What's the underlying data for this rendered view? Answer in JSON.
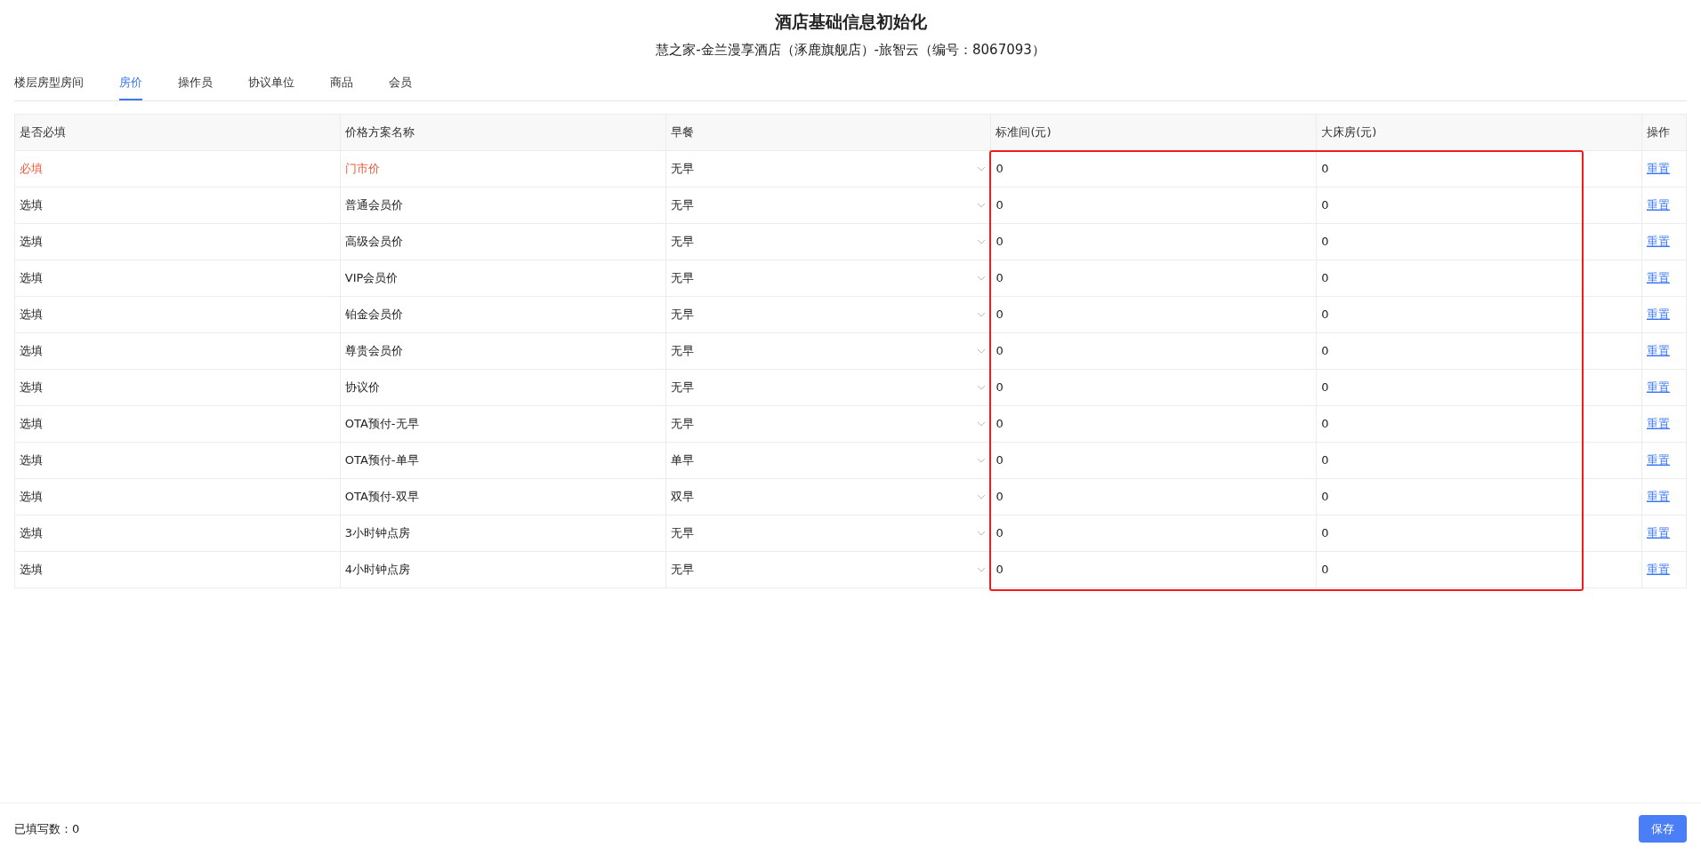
{
  "title": "酒店基础信息初始化",
  "subtitle": "慧之家-金兰漫享酒店（涿鹿旗舰店）-旅智云（编号：8067093）",
  "tabs": [
    {
      "label": "楼层房型房间",
      "selected": false
    },
    {
      "label": "房价",
      "selected": true
    },
    {
      "label": "操作员",
      "selected": false
    },
    {
      "label": "协议单位",
      "selected": false
    },
    {
      "label": "商品",
      "selected": false
    },
    {
      "label": "会员",
      "selected": false
    }
  ],
  "table": {
    "highlight_frame": true,
    "columns": [
      {
        "label": "是否必填",
        "kind": "text"
      },
      {
        "label": "价格方案名称",
        "kind": "text"
      },
      {
        "label": "早餐",
        "kind": "select"
      },
      {
        "label": "标准间(元)",
        "kind": "price"
      },
      {
        "label": "大床房(元)",
        "kind": "price"
      },
      {
        "label": "操作",
        "kind": "action"
      }
    ],
    "rows": [
      {
        "required": true,
        "requirement": "必填",
        "plan": "门市价",
        "breakfast": "无早",
        "standard": "0",
        "king": "0",
        "action": "重置"
      },
      {
        "required": false,
        "requirement": "选填",
        "plan": "普通会员价",
        "breakfast": "无早",
        "standard": "0",
        "king": "0",
        "action": "重置"
      },
      {
        "required": false,
        "requirement": "选填",
        "plan": "高级会员价",
        "breakfast": "无早",
        "standard": "0",
        "king": "0",
        "action": "重置"
      },
      {
        "required": false,
        "requirement": "选填",
        "plan": "VIP会员价",
        "breakfast": "无早",
        "standard": "0",
        "king": "0",
        "action": "重置"
      },
      {
        "required": false,
        "requirement": "选填",
        "plan": "铂金会员价",
        "breakfast": "无早",
        "standard": "0",
        "king": "0",
        "action": "重置"
      },
      {
        "required": false,
        "requirement": "选填",
        "plan": "尊贵会员价",
        "breakfast": "无早",
        "standard": "0",
        "king": "0",
        "action": "重置"
      },
      {
        "required": false,
        "requirement": "选填",
        "plan": "协议价",
        "breakfast": "无早",
        "standard": "0",
        "king": "0",
        "action": "重置"
      },
      {
        "required": false,
        "requirement": "选填",
        "plan": "OTA预付-无早",
        "breakfast": "无早",
        "standard": "0",
        "king": "0",
        "action": "重置"
      },
      {
        "required": false,
        "requirement": "选填",
        "plan": "OTA预付-单早",
        "breakfast": "单早",
        "standard": "0",
        "king": "0",
        "action": "重置"
      },
      {
        "required": false,
        "requirement": "选填",
        "plan": "OTA预付-双早",
        "breakfast": "双早",
        "standard": "0",
        "king": "0",
        "action": "重置"
      },
      {
        "required": false,
        "requirement": "选填",
        "plan": "3小时钟点房",
        "breakfast": "无早",
        "standard": "0",
        "king": "0",
        "action": "重置"
      },
      {
        "required": false,
        "requirement": "选填",
        "plan": "4小时钟点房",
        "breakfast": "无早",
        "standard": "0",
        "king": "0",
        "action": "重置"
      }
    ]
  },
  "footer": {
    "count_label": "已填写数：0",
    "save": "保存"
  }
}
